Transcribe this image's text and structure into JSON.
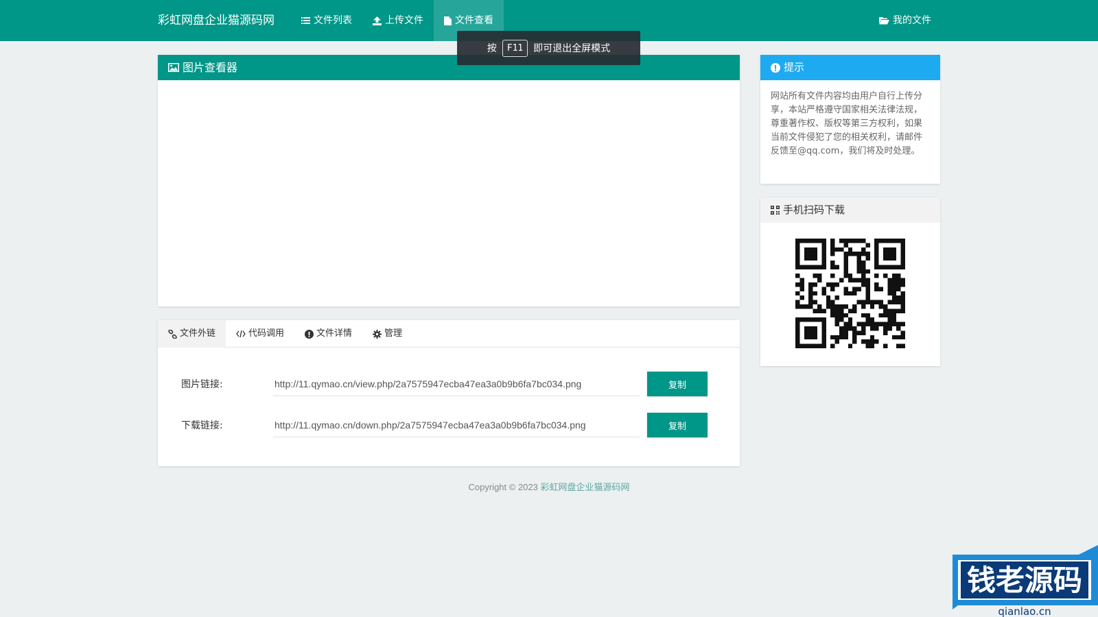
{
  "navbar": {
    "brand": "彩虹网盘企业猫源码网",
    "items": [
      {
        "label": "文件列表",
        "icon": "list-icon"
      },
      {
        "label": "上传文件",
        "icon": "upload-icon"
      },
      {
        "label": "文件查看",
        "icon": "file-icon",
        "active": true
      }
    ],
    "right": {
      "label": "我的文件",
      "icon": "folder-open-icon"
    }
  },
  "fullscreen_tip": {
    "prefix": "按",
    "key": "F11",
    "suffix": "即可退出全屏模式"
  },
  "viewer": {
    "title": "图片查看器",
    "icon": "image-icon"
  },
  "tip_panel": {
    "title": "提示",
    "icon": "info-circle-icon",
    "body": "网站所有文件内容均由用户自行上传分享，本站严格遵守国家相关法律法规，尊重著作权、版权等第三方权利，如果当前文件侵犯了您的相关权利，请邮件反馈至@qq.com，我们将及时处理。"
  },
  "qr_panel": {
    "title": "手机扫码下载",
    "icon": "qrcode-icon"
  },
  "tabs": [
    {
      "label": "文件外链",
      "icon": "link-icon",
      "active": true
    },
    {
      "label": "代码调用",
      "icon": "code-icon"
    },
    {
      "label": "文件详情",
      "icon": "info-circle-icon"
    },
    {
      "label": "管理",
      "icon": "gear-icon"
    }
  ],
  "links": {
    "image_label": "图片链接:",
    "image_url": "http://11.qymao.cn/view.php/2a7575947ecba47ea3a0b9b6fa7bc034.png",
    "download_label": "下载链接:",
    "download_url": "http://11.qymao.cn/down.php/2a7575947ecba47ea3a0b9b6fa7bc034.png",
    "copy_label": "复制"
  },
  "footer": {
    "prefix": "Copyright © 2023",
    "link": "彩虹网盘企业猫源码网"
  },
  "watermark": {
    "text": "钱老源码",
    "domain": "qianlao.cn"
  },
  "colors": {
    "primary": "#009688",
    "info": "#1eaaf1",
    "background": "#ecf0f1"
  }
}
